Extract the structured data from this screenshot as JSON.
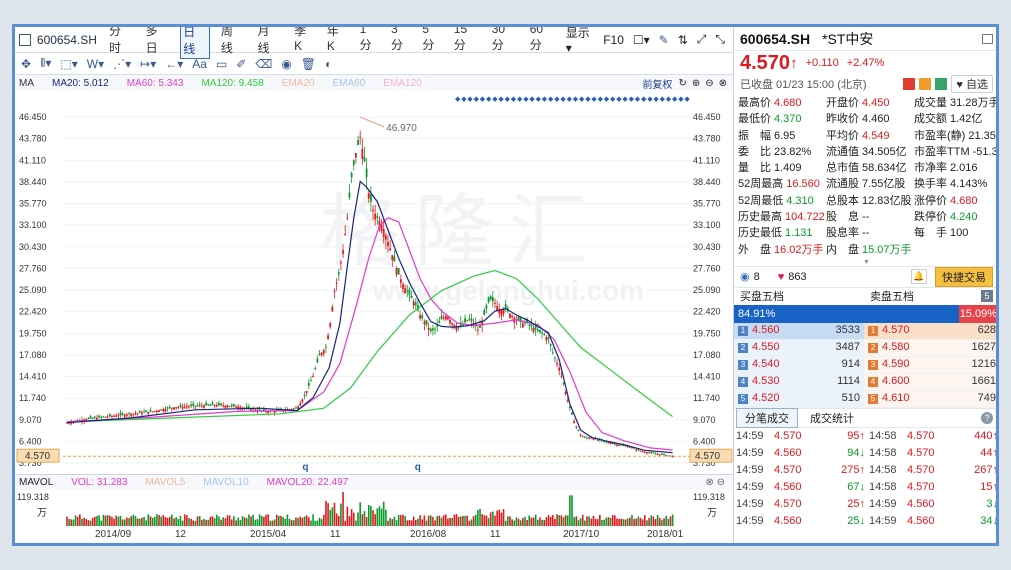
{
  "toolbar": {
    "code": "600654.SH",
    "periods": [
      "分时",
      "多日",
      "日线",
      "周线",
      "月线",
      "季K",
      "年K",
      "1分",
      "3分",
      "5分",
      "15分",
      "30分",
      "60分"
    ],
    "active_period": "日线",
    "display_label": "显示▾",
    "f10_label": "F10"
  },
  "ma_header": {
    "ma_label": "MA",
    "ma20": "MA20: 5.012",
    "ma60": "MA60: 5.343",
    "ma120": "MA120: 9.458",
    "ema_a": "EMA20",
    "ema_b": "EMA60",
    "ema_c": "EMA120",
    "fq_label": "前复权"
  },
  "price_axis": [
    "46.450",
    "43.780",
    "41.110",
    "38.440",
    "35.770",
    "33.100",
    "30.430",
    "27.760",
    "25.090",
    "22.420",
    "19.750",
    "17.080",
    "14.410",
    "11.740",
    "9.070",
    "6.400",
    "3.730"
  ],
  "price_axis_right": [
    "46.450",
    "43.780",
    "41.110",
    "38.440",
    "35.770",
    "33.100",
    "30.430",
    "27.760",
    "25.090",
    "22.420",
    "19.750",
    "17.080",
    "14.410",
    "11.740",
    "9.070",
    "6.400",
    "3.730"
  ],
  "current_price_tag": "4.570",
  "peak_label": "46.970",
  "q_marker": "q",
  "vol_header": {
    "label": "MAVOL",
    "vol": "VOL: 31.283",
    "mavol5": "MAVOL5",
    "mavol10": "MAVOL10",
    "mavol20": "MAVOL20: 22.497"
  },
  "vol_axis": {
    "top": "119.318",
    "unit": "万"
  },
  "x_axis": [
    "2014/09",
    "12",
    "2015/04",
    "11",
    "2016/08",
    "11",
    "2017/10",
    "2018/01"
  ],
  "watermark": {
    "cn": "格隆汇",
    "en": "www.gelonghui.com"
  },
  "colors": {
    "up": "#e0191e",
    "down": "#0a9a2a",
    "ma20": "#1a237e",
    "ma60": "#e13bd0",
    "ma120": "#2ecc40",
    "accent": "#1863c5"
  },
  "chart_data": {
    "type": "candlestick",
    "x_start": "2014/09",
    "x_end": "2018/01",
    "ylim": [
      3.73,
      46.97
    ],
    "close_path": [
      [
        0,
        8.7
      ],
      [
        20,
        9.2
      ],
      [
        40,
        9.5
      ],
      [
        60,
        9.8
      ],
      [
        80,
        10.1
      ],
      [
        100,
        10.6
      ],
      [
        120,
        10.8
      ],
      [
        140,
        10.9
      ],
      [
        160,
        10.7
      ],
      [
        175,
        10.3
      ],
      [
        190,
        10.1
      ],
      [
        205,
        10.3
      ],
      [
        215,
        10.5
      ],
      [
        222,
        12.0
      ],
      [
        230,
        14.5
      ],
      [
        236,
        17.0
      ],
      [
        242,
        18.0
      ],
      [
        246,
        21.0
      ],
      [
        250,
        25.0
      ],
      [
        254,
        27.0
      ],
      [
        258,
        30.0
      ],
      [
        262,
        34.0
      ],
      [
        266,
        39.0
      ],
      [
        270,
        42.0
      ],
      [
        274,
        44.0
      ],
      [
        278,
        41.0
      ],
      [
        282,
        37.0
      ],
      [
        286,
        35.0
      ],
      [
        290,
        34.0
      ],
      [
        295,
        33.0
      ],
      [
        300,
        31.0
      ],
      [
        305,
        29.0
      ],
      [
        310,
        27.0
      ],
      [
        315,
        25.5
      ],
      [
        320,
        24.5
      ],
      [
        325,
        23.5
      ],
      [
        330,
        22.0
      ],
      [
        335,
        21.0
      ],
      [
        340,
        20.0
      ],
      [
        345,
        20.3
      ],
      [
        350,
        21.5
      ],
      [
        355,
        22.0
      ],
      [
        360,
        21.0
      ],
      [
        365,
        20.5
      ],
      [
        370,
        20.8
      ],
      [
        375,
        21.5
      ],
      [
        380,
        21.0
      ],
      [
        385,
        20.0
      ],
      [
        390,
        22.0
      ],
      [
        395,
        24.0
      ],
      [
        400,
        23.5
      ],
      [
        405,
        22.5
      ],
      [
        410,
        22.8
      ],
      [
        415,
        22.0
      ],
      [
        420,
        21.5
      ],
      [
        425,
        21.0
      ],
      [
        430,
        21.0
      ],
      [
        435,
        20.5
      ],
      [
        440,
        20.0
      ],
      [
        445,
        19.7
      ],
      [
        450,
        19.0
      ],
      [
        455,
        17.0
      ],
      [
        460,
        15.5
      ],
      [
        465,
        13.0
      ],
      [
        470,
        10.5
      ],
      [
        475,
        8.5
      ],
      [
        480,
        7.2
      ],
      [
        485,
        6.8
      ],
      [
        490,
        6.9
      ],
      [
        495,
        6.6
      ],
      [
        500,
        6.5
      ],
      [
        505,
        6.3
      ],
      [
        510,
        6.2
      ],
      [
        515,
        6.0
      ],
      [
        520,
        5.9
      ],
      [
        525,
        5.8
      ],
      [
        530,
        5.5
      ],
      [
        535,
        5.3
      ],
      [
        540,
        5.1
      ],
      [
        545,
        5.0
      ],
      [
        550,
        4.9
      ],
      [
        555,
        4.8
      ],
      [
        560,
        4.7
      ],
      [
        566,
        4.57
      ]
    ],
    "ma20_path": [
      [
        0,
        8.7
      ],
      [
        60,
        9.3
      ],
      [
        120,
        10.3
      ],
      [
        180,
        10.5
      ],
      [
        215,
        10.2
      ],
      [
        230,
        11.8
      ],
      [
        245,
        15.5
      ],
      [
        255,
        21.0
      ],
      [
        262,
        28.0
      ],
      [
        268,
        34.0
      ],
      [
        274,
        38.5
      ],
      [
        280,
        37.8
      ],
      [
        290,
        36.0
      ],
      [
        300,
        32.5
      ],
      [
        310,
        29.0
      ],
      [
        320,
        26.0
      ],
      [
        330,
        23.5
      ],
      [
        340,
        21.2
      ],
      [
        350,
        20.6
      ],
      [
        360,
        20.5
      ],
      [
        375,
        20.7
      ],
      [
        390,
        21.3
      ],
      [
        400,
        22.5
      ],
      [
        410,
        22.8
      ],
      [
        420,
        22.0
      ],
      [
        430,
        21.4
      ],
      [
        440,
        20.6
      ],
      [
        450,
        19.8
      ],
      [
        460,
        16.5
      ],
      [
        470,
        11.0
      ],
      [
        480,
        7.8
      ],
      [
        490,
        6.9
      ],
      [
        505,
        6.4
      ],
      [
        520,
        6.0
      ],
      [
        540,
        5.3
      ],
      [
        566,
        5.0
      ]
    ],
    "ma60_path": [
      [
        0,
        8.8
      ],
      [
        80,
        9.4
      ],
      [
        160,
        10.1
      ],
      [
        215,
        10.2
      ],
      [
        240,
        12.5
      ],
      [
        255,
        16.0
      ],
      [
        270,
        23.0
      ],
      [
        282,
        29.0
      ],
      [
        292,
        33.0
      ],
      [
        300,
        34.0
      ],
      [
        310,
        33.5
      ],
      [
        320,
        30.0
      ],
      [
        330,
        26.5
      ],
      [
        340,
        24.0
      ],
      [
        350,
        22.5
      ],
      [
        365,
        21.0
      ],
      [
        380,
        20.7
      ],
      [
        400,
        21.0
      ],
      [
        420,
        21.4
      ],
      [
        440,
        20.8
      ],
      [
        455,
        19.0
      ],
      [
        470,
        15.0
      ],
      [
        485,
        10.0
      ],
      [
        500,
        7.5
      ],
      [
        520,
        6.5
      ],
      [
        545,
        5.6
      ],
      [
        566,
        5.34
      ]
    ],
    "ma120_path": [
      [
        0,
        8.8
      ],
      [
        100,
        9.3
      ],
      [
        200,
        9.8
      ],
      [
        240,
        10.5
      ],
      [
        265,
        13.0
      ],
      [
        290,
        17.5
      ],
      [
        320,
        22.0
      ],
      [
        350,
        25.0
      ],
      [
        380,
        26.8
      ],
      [
        400,
        27.5
      ],
      [
        420,
        26.5
      ],
      [
        440,
        24.0
      ],
      [
        460,
        21.0
      ],
      [
        480,
        18.0
      ],
      [
        510,
        15.0
      ],
      [
        540,
        12.0
      ],
      [
        566,
        9.46
      ]
    ]
  },
  "quote": {
    "code": "600654.SH",
    "name": "*ST中安",
    "price": "4.570",
    "arrow": "↑",
    "change": "+0.110",
    "pct": "+2.47%",
    "time": "已收盘 01/23 15:00 (北京)",
    "watch_label": "自选",
    "stats": [
      [
        "最高价",
        "4.680",
        "red"
      ],
      [
        "开盘价",
        "4.450",
        "red"
      ],
      [
        "成交量",
        "31.28万手",
        ""
      ],
      [
        "最低价",
        "4.370",
        "grn"
      ],
      [
        "昨收价",
        "4.460",
        ""
      ],
      [
        "成交额",
        "1.42亿",
        ""
      ],
      [
        "振　幅",
        "6.95",
        ""
      ],
      [
        "平均价",
        "4.549",
        "red"
      ],
      [
        "市盈率(静)",
        "21.355",
        ""
      ],
      [
        "委　比",
        "23.82%",
        ""
      ],
      [
        "流通值",
        "34.505亿",
        ""
      ],
      [
        "市盈率TTM",
        "-51.348",
        ""
      ],
      [
        "量　比",
        "1.409",
        ""
      ],
      [
        "总市值",
        "58.634亿",
        ""
      ],
      [
        "市净率",
        "2.016",
        ""
      ],
      [
        "52周最高",
        "16.560",
        "red"
      ],
      [
        "流通股",
        "7.55亿股",
        ""
      ],
      [
        "换手率",
        "4.143%",
        ""
      ],
      [
        "52周最低",
        "4.310",
        "grn"
      ],
      [
        "总股本",
        "12.83亿股",
        ""
      ],
      [
        "涨停价",
        "4.680",
        "red"
      ],
      [
        "历史最高",
        "104.722",
        "red"
      ],
      [
        "股　息",
        "--",
        ""
      ],
      [
        "跌停价",
        "4.240",
        "grn"
      ],
      [
        "历史最低",
        "1.131",
        "grn"
      ],
      [
        "股息率",
        "--",
        ""
      ],
      [
        "每　手",
        "100",
        ""
      ],
      [
        "外　盘",
        "16.02万手",
        "red"
      ],
      [
        "内　盘",
        "15.07万手",
        "grn"
      ],
      [
        "",
        "",
        " "
      ]
    ],
    "followers": "8",
    "likes": "863",
    "quick_trade": "快捷交易"
  },
  "orderbook": {
    "buy_title": "买盘五档",
    "sell_title": "卖盘五档",
    "buy_pct": "84.91%",
    "sell_pct": "15.09%",
    "bids": [
      [
        "1",
        "4.560",
        "3533"
      ],
      [
        "2",
        "4.550",
        "3487"
      ],
      [
        "3",
        "4.540",
        "914"
      ],
      [
        "4",
        "4.530",
        "1114"
      ],
      [
        "5",
        "4.520",
        "510"
      ]
    ],
    "asks": [
      [
        "1",
        "4.570",
        "628"
      ],
      [
        "2",
        "4.580",
        "1627"
      ],
      [
        "3",
        "4.590",
        "1216"
      ],
      [
        "4",
        "4.600",
        "1661"
      ],
      [
        "5",
        "4.610",
        "749"
      ]
    ]
  },
  "trades": {
    "tab_active": "分笔成交",
    "tab_other": "成交统计",
    "rows": [
      [
        "14:59",
        "4.570",
        "95↑",
        "14:58",
        "4.570",
        "440↑"
      ],
      [
        "14:59",
        "4.560",
        "94↓",
        "14:58",
        "4.570",
        "44↑"
      ],
      [
        "14:59",
        "4.570",
        "275↑",
        "14:58",
        "4.570",
        "267↑"
      ],
      [
        "14:59",
        "4.560",
        "67↓",
        "14:58",
        "4.570",
        "15↑"
      ],
      [
        "14:59",
        "4.570",
        "25↑",
        "14:59",
        "4.560",
        "3↓"
      ],
      [
        "14:59",
        "4.560",
        "25↓",
        "14:59",
        "4.560",
        "34↓"
      ]
    ]
  }
}
